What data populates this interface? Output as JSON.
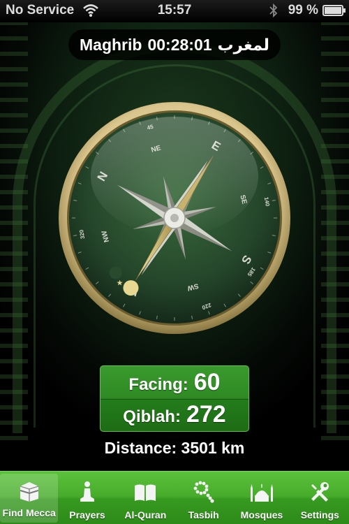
{
  "status_bar": {
    "carrier": "No Service",
    "time": "15:57",
    "battery": "99 %"
  },
  "prayer": {
    "name": "Maghrib",
    "countdown": "00:28:01",
    "arabic_name": "لمغرب"
  },
  "compass": {
    "heading_degrees": 60,
    "qibla_degrees": 272,
    "cardinals": {
      "N": "N",
      "E": "E",
      "S": "S",
      "W": "W"
    },
    "intercardinals": {
      "NE": "NE",
      "SE": "SE",
      "SW": "SW",
      "NW": "NW"
    },
    "degree_labels": [
      "45",
      "140",
      "185",
      "220",
      "320"
    ],
    "colors": {
      "face": "#25442a",
      "rim": "#c9b57a",
      "needle": "#d7c27a",
      "pointer": "#cfd2cc"
    }
  },
  "readout": {
    "facing_label": "Facing:",
    "facing_value": "60",
    "qiblah_label": "Qiblah:",
    "qiblah_value": "272"
  },
  "distance": "Distance: 3501 km",
  "tabs": [
    {
      "label": "Find Mecca",
      "icon": "kaaba-icon",
      "active": true
    },
    {
      "label": "Prayers",
      "icon": "prayer-person-icon",
      "active": false
    },
    {
      "label": "Al-Quran",
      "icon": "book-icon",
      "active": false
    },
    {
      "label": "Tasbih",
      "icon": "prayer-beads-icon",
      "active": false
    },
    {
      "label": "Mosques",
      "icon": "mosque-icon",
      "active": false
    },
    {
      "label": "Settings",
      "icon": "tools-icon",
      "active": false
    }
  ],
  "theme": {
    "accent": "#3f9f2a",
    "background": "#0d1f10"
  }
}
